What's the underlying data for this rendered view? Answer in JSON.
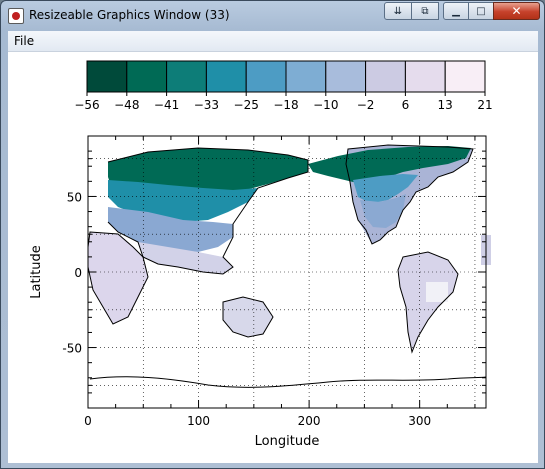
{
  "window": {
    "title": "Resizeable Graphics Window (33)",
    "buttons": {
      "pin": "⇊",
      "restore_alt": "⧉",
      "minimize": "▁",
      "maximize": "□",
      "close": "✕"
    }
  },
  "menu": {
    "file_label": "File"
  },
  "colorbar": {
    "tick_labels": [
      "−56",
      "−48",
      "−41",
      "−33",
      "−25",
      "−18",
      "−10",
      "−2",
      "6",
      "13",
      "21"
    ],
    "colors": [
      "#004a3a",
      "#006a55",
      "#0d7d78",
      "#1f8fa8",
      "#4d9cc4",
      "#7eadd3",
      "#a8bcdc",
      "#cccbe3",
      "#e5dced",
      "#f8eef6"
    ]
  },
  "chart_data": {
    "type": "heatmap",
    "title": "",
    "xlabel": "Longitude",
    "ylabel": "Latitude",
    "xlim": [
      0,
      360
    ],
    "ylim": [
      -90,
      90
    ],
    "x_ticks": [
      0,
      100,
      200,
      300
    ],
    "y_ticks": [
      -50,
      0,
      50
    ],
    "grid": true,
    "colorbar_range": [
      -56,
      21
    ],
    "colorbar_ticks": [
      -56,
      -48,
      -41,
      -33,
      -25,
      -18,
      -10,
      -2,
      6,
      13,
      21
    ]
  }
}
